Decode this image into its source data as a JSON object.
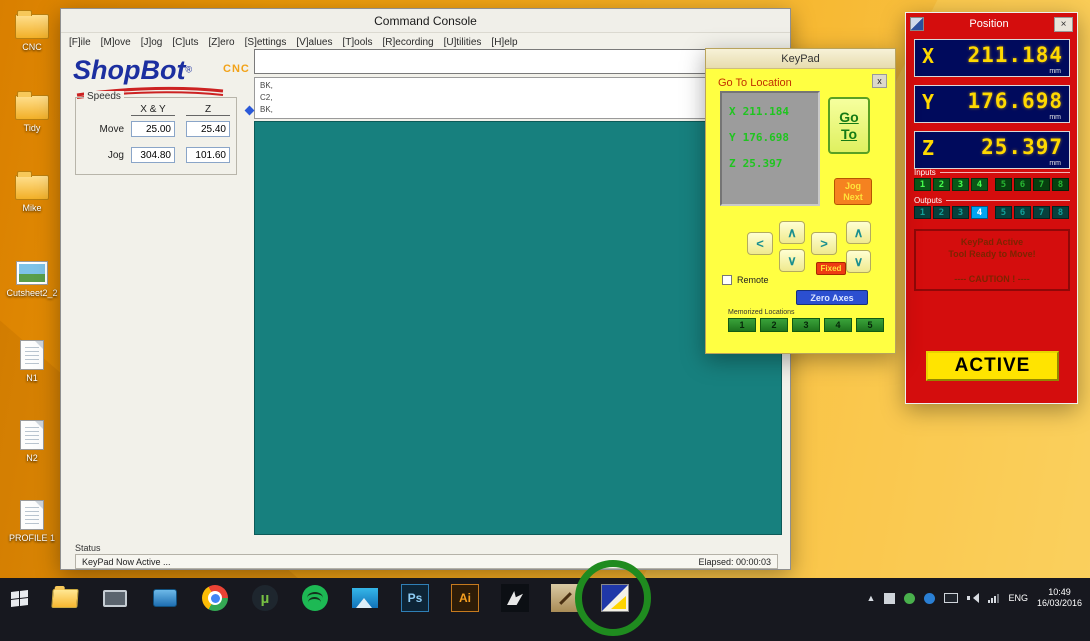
{
  "desktop": {
    "icons": [
      {
        "label": "CNC",
        "type": "folder"
      },
      {
        "label": "Tidy",
        "type": "folder"
      },
      {
        "label": "Mike",
        "type": "folder"
      },
      {
        "label": "Cutsheet2_2",
        "type": "image"
      },
      {
        "label": "N1",
        "type": "document"
      },
      {
        "label": "N2",
        "type": "document"
      },
      {
        "label": "PROFILE 1",
        "type": "document"
      }
    ]
  },
  "console": {
    "title": "Command Console",
    "menu": [
      "[F]ile",
      "[M]ove",
      "[J]og",
      "[C]uts",
      "[Z]ero",
      "[S]ettings",
      "[V]alues",
      "[T]ools",
      "[R]ecording",
      "[U]tilities",
      "[H]elp"
    ],
    "logo": {
      "name": "ShopBot",
      "reg": "®",
      "tag": "CNC"
    },
    "speeds": {
      "title": "Speeds",
      "col_xy": "X & Y",
      "col_z": "Z",
      "move_label": "Move",
      "move_xy": "25.00",
      "move_z": "25.40",
      "jog_label": "Jog",
      "jog_xy": "304.80",
      "jog_z": "101.60"
    },
    "command_input": {
      "value": ""
    },
    "output_lines": [
      "BK,",
      "C2,",
      "BK,"
    ],
    "status": {
      "label": "Status",
      "message": "KeyPad Now Active ...",
      "elapsed": "Elapsed: 00:00:03"
    }
  },
  "keypad": {
    "title": "KeyPad",
    "goto_title": "Go To Location",
    "close_label": "x",
    "display": {
      "rows": [
        {
          "label": "X",
          "value": "211.184"
        },
        {
          "label": "Y",
          "value": "176.698"
        },
        {
          "label": "Z",
          "value": "25.397"
        }
      ]
    },
    "goto_button": {
      "line1": "Go",
      "line2": "To"
    },
    "jog_next": {
      "line1": "Jog",
      "line2": "Next"
    },
    "arrows": {
      "up": "∧",
      "down": "∨",
      "left": "<",
      "right": ">",
      "z_up": "∧",
      "z_down": "∨"
    },
    "fixed_button": "Fixed",
    "remote_label": "Remote",
    "zero_axes_button": "Zero Axes",
    "memorized_label": "Memorized Locations",
    "memorized_buttons": [
      "1",
      "2",
      "3",
      "4",
      "5"
    ]
  },
  "position": {
    "title": "Position",
    "close_label": "×",
    "axes": [
      {
        "label": "X",
        "value": "211.184",
        "unit": "mm"
      },
      {
        "label": "Y",
        "value": "176.698",
        "unit": "mm"
      },
      {
        "label": "Z",
        "value": "25.397",
        "unit": "mm"
      }
    ],
    "inputs_label": "Inputs",
    "input_leds": [
      "1",
      "2",
      "3",
      "4",
      "5",
      "6",
      "7",
      "8"
    ],
    "outputs_label": "Outputs",
    "output_leds": [
      "1",
      "2",
      "3",
      "4",
      "5",
      "6",
      "7",
      "8"
    ],
    "active_output": "4",
    "warning": {
      "line1": "KeyPad Active",
      "line2": "Tool Ready to Move!",
      "line3": "---- CAUTION ! ----"
    },
    "active_button": "ACTIVE"
  },
  "taskbar": {
    "photoshop_label": "Ps",
    "illustrator_label": "Ai",
    "utorrent_label": "µ",
    "app_icons": [
      "start",
      "file-explorer",
      "system-monitor",
      "media-app",
      "chrome",
      "utorrent",
      "spotify",
      "photos",
      "photoshop",
      "illustrator",
      "cnc-cam-app",
      "editor-app",
      "shopbot"
    ],
    "tray_icons": [
      "hidden-icons-arrow",
      "grid-icon",
      "green-status-icon",
      "blue-status-icon",
      "monitor-icon",
      "volume-icon",
      "network-icon"
    ],
    "tray": {
      "language": "ENG",
      "time": "10:49",
      "date": "16/03/2016"
    }
  },
  "annotation": {
    "highlight_color": "#1f8b1f"
  }
}
